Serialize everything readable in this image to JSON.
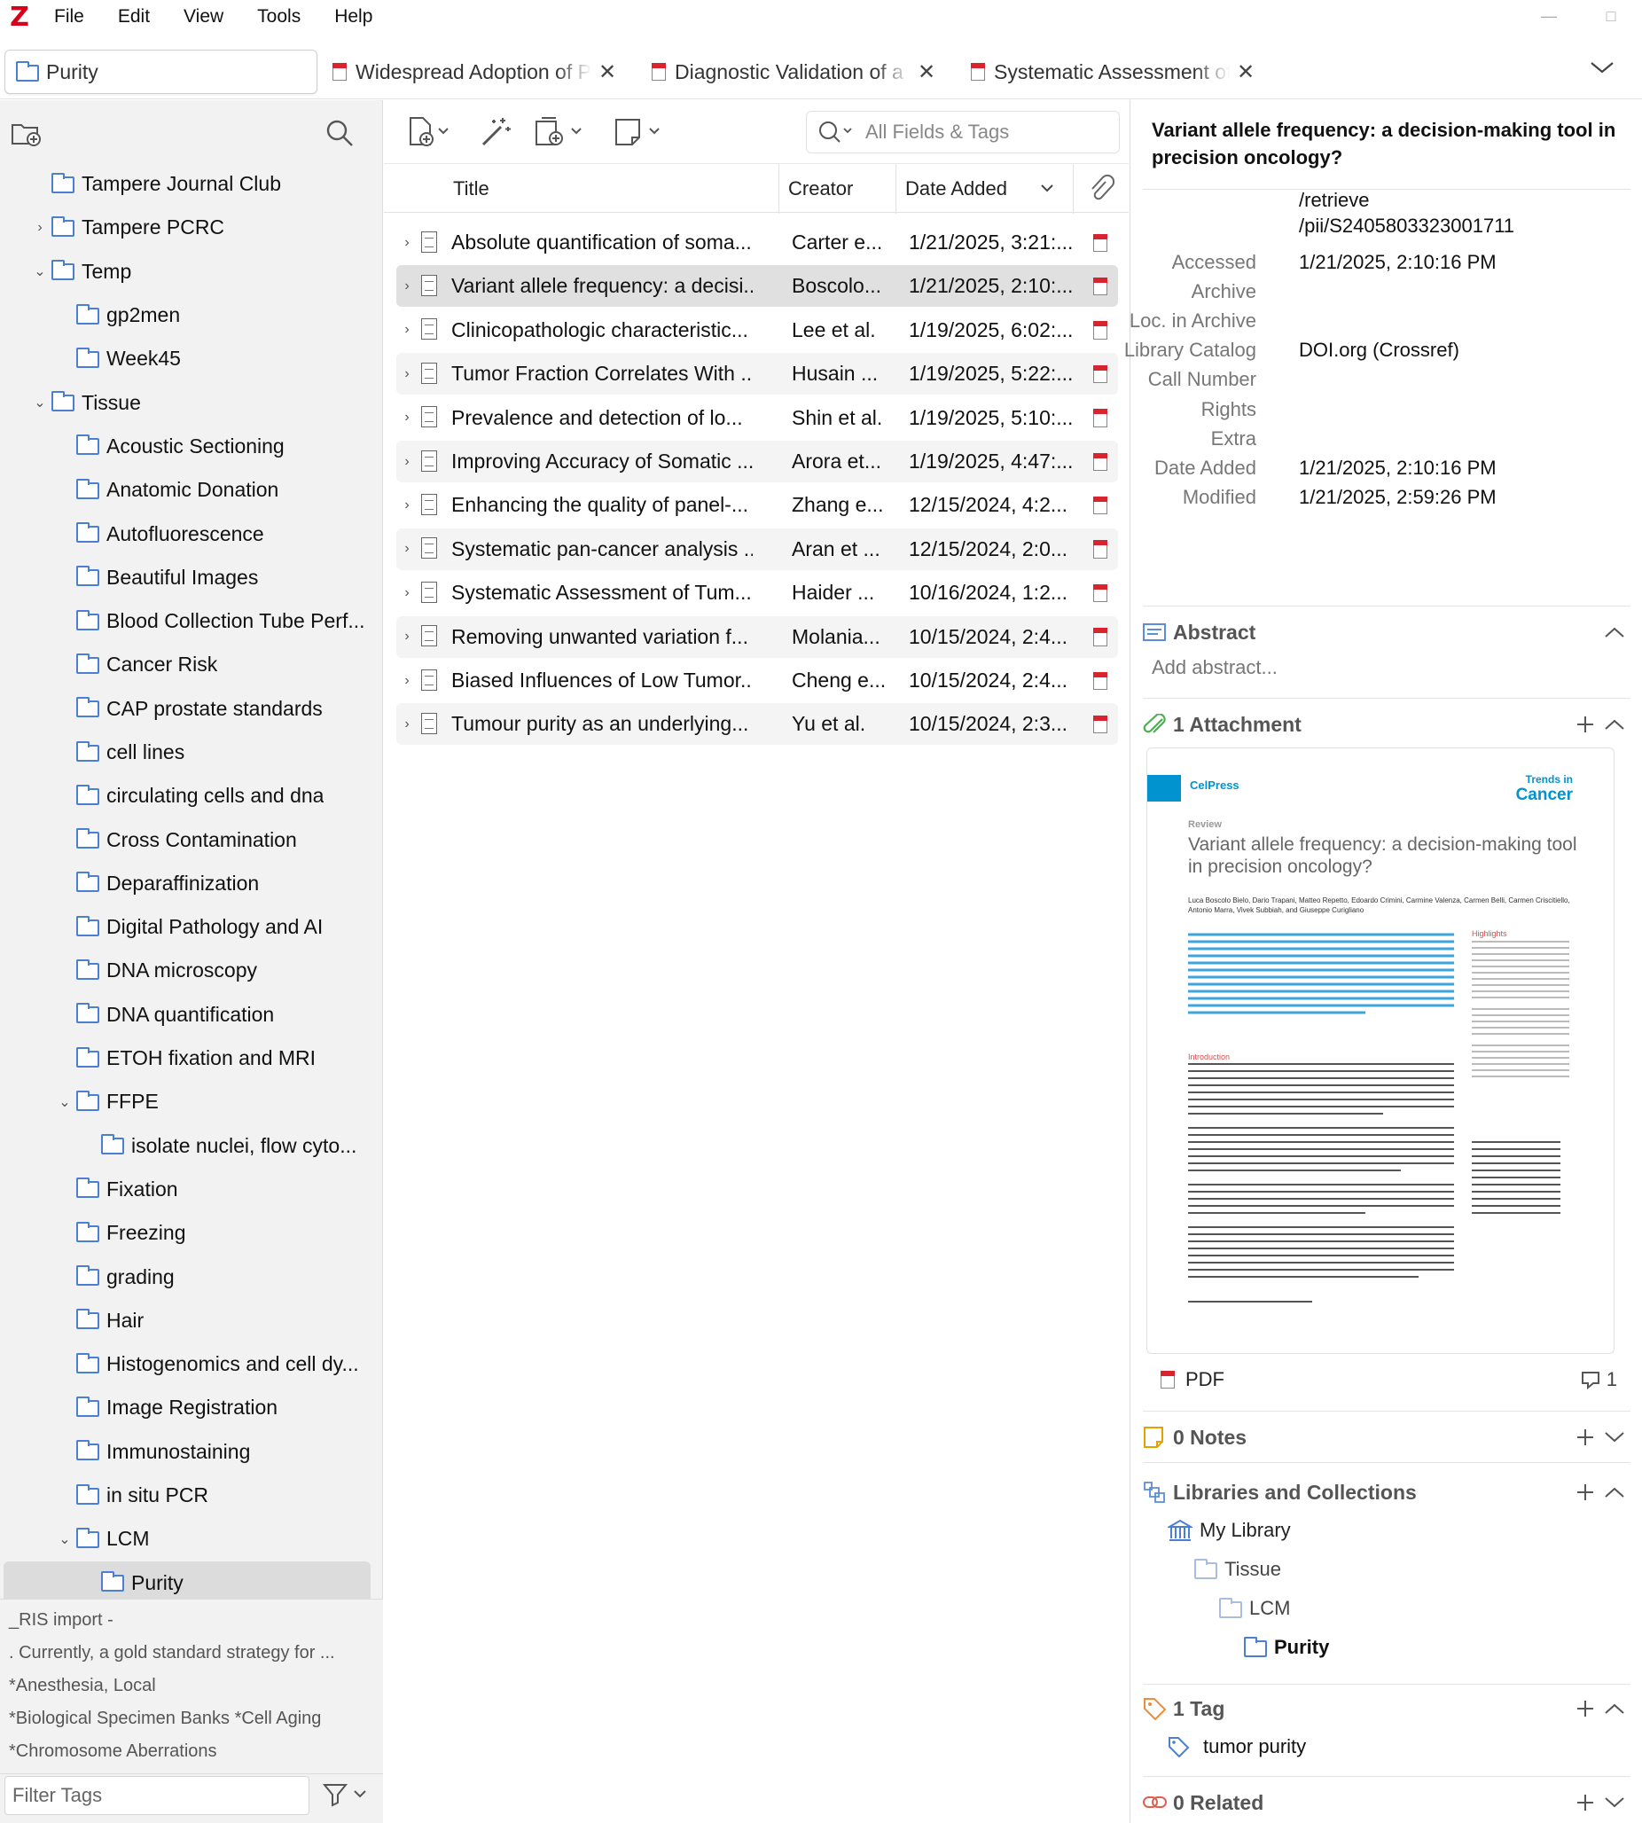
{
  "app": {
    "logo": "Z",
    "menu": [
      "File",
      "Edit",
      "View",
      "Tools",
      "Help"
    ],
    "window_controls": [
      "—",
      "□"
    ]
  },
  "tabs": [
    {
      "label": "Purity",
      "type": "library"
    },
    {
      "label": "Widespread Adoption of P",
      "type": "pdf"
    },
    {
      "label": "Diagnostic Validation of a",
      "type": "pdf"
    },
    {
      "label": "Systematic Assessment of",
      "type": "pdf"
    }
  ],
  "collections": [
    {
      "label": "Tampere Journal Club",
      "level": 1,
      "twisty": ""
    },
    {
      "label": "Tampere PCRC",
      "level": 1,
      "twisty": "›"
    },
    {
      "label": "Temp",
      "level": 1,
      "twisty": "⌄"
    },
    {
      "label": "gp2men",
      "level": 2,
      "twisty": ""
    },
    {
      "label": "Week45",
      "level": 2,
      "twisty": ""
    },
    {
      "label": "Tissue",
      "level": 1,
      "twisty": "⌄"
    },
    {
      "label": "Acoustic Sectioning",
      "level": 2,
      "twisty": ""
    },
    {
      "label": "Anatomic Donation",
      "level": 2,
      "twisty": ""
    },
    {
      "label": "Autofluorescence",
      "level": 2,
      "twisty": ""
    },
    {
      "label": "Beautiful Images",
      "level": 2,
      "twisty": ""
    },
    {
      "label": "Blood Collection Tube Perf...",
      "level": 2,
      "twisty": ""
    },
    {
      "label": "Cancer Risk",
      "level": 2,
      "twisty": ""
    },
    {
      "label": "CAP prostate standards",
      "level": 2,
      "twisty": ""
    },
    {
      "label": "cell lines",
      "level": 2,
      "twisty": ""
    },
    {
      "label": "circulating cells and dna",
      "level": 2,
      "twisty": ""
    },
    {
      "label": "Cross Contamination",
      "level": 2,
      "twisty": ""
    },
    {
      "label": "Deparaffinization",
      "level": 2,
      "twisty": ""
    },
    {
      "label": "Digital Pathology and AI",
      "level": 2,
      "twisty": ""
    },
    {
      "label": "DNA microscopy",
      "level": 2,
      "twisty": ""
    },
    {
      "label": "DNA quantification",
      "level": 2,
      "twisty": ""
    },
    {
      "label": "ETOH fixation and MRI",
      "level": 2,
      "twisty": ""
    },
    {
      "label": "FFPE",
      "level": 2,
      "twisty": "⌄"
    },
    {
      "label": "isolate nuclei, flow cyto...",
      "level": 3,
      "twisty": ""
    },
    {
      "label": "Fixation",
      "level": 2,
      "twisty": ""
    },
    {
      "label": "Freezing",
      "level": 2,
      "twisty": ""
    },
    {
      "label": "grading",
      "level": 2,
      "twisty": ""
    },
    {
      "label": "Hair",
      "level": 2,
      "twisty": ""
    },
    {
      "label": "Histogenomics and cell dy...",
      "level": 2,
      "twisty": ""
    },
    {
      "label": "Image Registration",
      "level": 2,
      "twisty": ""
    },
    {
      "label": "Immunostaining",
      "level": 2,
      "twisty": ""
    },
    {
      "label": "in situ PCR",
      "level": 2,
      "twisty": ""
    },
    {
      "label": "LCM",
      "level": 2,
      "twisty": "⌄"
    },
    {
      "label": "Purity",
      "level": 3,
      "twisty": "",
      "selected": true
    }
  ],
  "tags_pane": {
    "lines": [
      "_RIS import   -",
      ". Currently, a gold standard strategy for ...",
      "*Anesthesia, Local",
      "*Biological Specimen Banks   *Cell Aging",
      "*Chromosome Aberrations"
    ],
    "filter_placeholder": "Filter Tags"
  },
  "items": {
    "search_placeholder": "All Fields & Tags",
    "columns": {
      "title": "Title",
      "creator": "Creator",
      "date_added": "Date Added"
    },
    "rows": [
      {
        "title": "Absolute quantification of soma...",
        "creator": "Carter e...",
        "date": "1/21/2025, 3:21:..."
      },
      {
        "title": "Variant allele frequency: a decisi...",
        "creator": "Boscolo...",
        "date": "1/21/2025, 2:10:...",
        "selected": true
      },
      {
        "title": "Clinicopathologic characteristic...",
        "creator": "Lee et al.",
        "date": "1/19/2025, 6:02:..."
      },
      {
        "title": "Tumor Fraction Correlates With ...",
        "creator": "Husain ...",
        "date": "1/19/2025, 5:22:..."
      },
      {
        "title": "Prevalence and detection of lo...",
        "creator": "Shin et al.",
        "date": "1/19/2025, 5:10:..."
      },
      {
        "title": "Improving Accuracy of Somatic ...",
        "creator": "Arora et...",
        "date": "1/19/2025, 4:47:..."
      },
      {
        "title": "Enhancing the quality of panel-...",
        "creator": "Zhang e...",
        "date": "12/15/2024, 4:2..."
      },
      {
        "title": "Systematic pan-cancer analysis ...",
        "creator": "Aran et ...",
        "date": "12/15/2024, 2:0..."
      },
      {
        "title": "Systematic Assessment of Tum...",
        "creator": "Haider ...",
        "date": "10/16/2024, 1:2..."
      },
      {
        "title": "Removing unwanted variation f...",
        "creator": "Molania...",
        "date": "10/15/2024, 2:4..."
      },
      {
        "title": "Biased Influences of Low Tumor...",
        "creator": "Cheng e...",
        "date": "10/15/2024, 2:4..."
      },
      {
        "title": "Tumour purity as an underlying...",
        "creator": "Yu et al.",
        "date": "10/15/2024, 2:3..."
      }
    ]
  },
  "detail": {
    "title": "Variant allele frequency: a decision-making tool in precision oncology?",
    "url_tail": [
      "/retrieve",
      "/pii/S2405803323001711"
    ],
    "fields": [
      {
        "k": "Accessed",
        "v": "1/21/2025, 2:10:16 PM"
      },
      {
        "k": "Archive",
        "v": ""
      },
      {
        "k": "Loc. in Archive",
        "v": ""
      },
      {
        "k": "Library Catalog",
        "v": "DOI.org (Crossref)"
      },
      {
        "k": "Call Number",
        "v": ""
      },
      {
        "k": "Rights",
        "v": ""
      },
      {
        "k": "Extra",
        "v": ""
      },
      {
        "k": "Date Added",
        "v": "1/21/2025, 2:10:16 PM"
      },
      {
        "k": "Modified",
        "v": "1/21/2025, 2:59:26 PM"
      }
    ],
    "abstract_header": "Abstract",
    "abstract_placeholder": "Add abstract...",
    "attachment_header": "1 Attachment",
    "attachment_name": "PDF",
    "attachment_count": "1",
    "notes_header": "0 Notes",
    "libraries_header": "Libraries and Collections",
    "library_path": [
      "My Library",
      "Tissue",
      "LCM",
      "Purity"
    ],
    "tags_header": "1 Tag",
    "tag": "tumor purity",
    "related_header": "0 Related"
  },
  "preview": {
    "publisher": "CelPress",
    "journal_small": "Trends in",
    "journal": "Cancer",
    "section": "Review",
    "title": "Variant allele frequency: a decision-making tool in precision oncology?",
    "authors": "Luca Boscolo Bielo, Dario Trapani, Matteo Repetto, Edoardo Crimini, Carmine Valenza, Carmen Belli, Carmen Criscitiello, Antonio Marra, Vivek Subbiah, and Giuseppe Curigliano",
    "highlights_label": "Highlights",
    "intro_label": "Introduction"
  },
  "colors": {
    "accent": "#4a7fd3",
    "pdf_red": "#d9232e",
    "selection": "#e0e0e0",
    "cellpress": "#0093d0"
  }
}
